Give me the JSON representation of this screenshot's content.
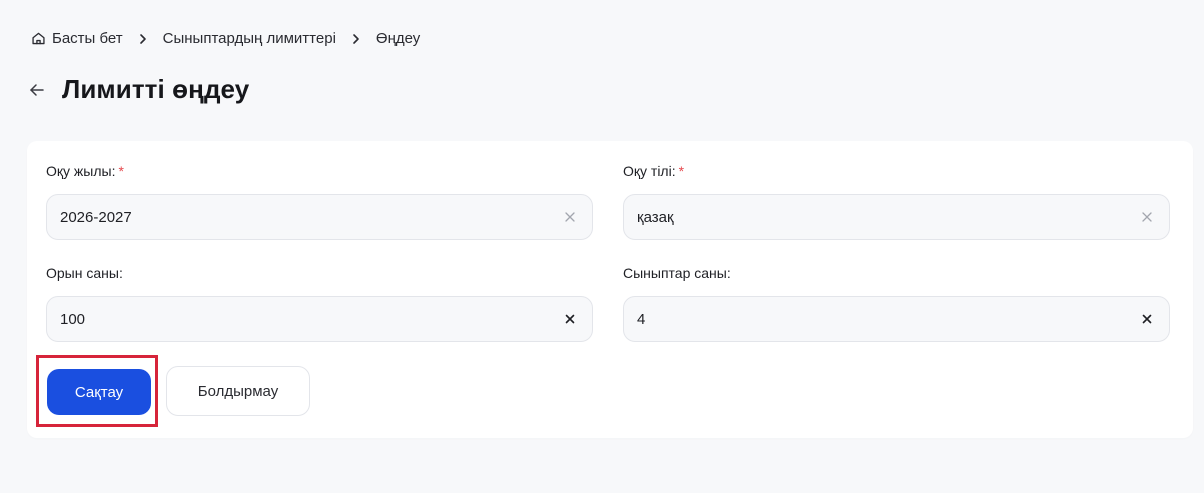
{
  "breadcrumb": {
    "home": "Басты бет",
    "limits": "Сыныптардың лимиттері",
    "current": "Өңдеу"
  },
  "page": {
    "title": "Лимитті өңдеу"
  },
  "form": {
    "year": {
      "label": "Оқу жылы:",
      "required": "*",
      "value": "2026-2027"
    },
    "language": {
      "label": "Оқу тілі:",
      "required": "*",
      "value": "қазақ"
    },
    "seats": {
      "label": "Орын саны:",
      "value": "100"
    },
    "classes": {
      "label": "Сыныптар саны:",
      "value": "4"
    }
  },
  "actions": {
    "save_label": "Сақтау",
    "cancel_label": "Болдырмау"
  },
  "colors": {
    "primary": "#1a4fe0",
    "required": "#e5484d",
    "highlight": "#d6243a",
    "background": "#f7f8fa"
  },
  "icons": {
    "home": "home-icon",
    "separator": "chevron-right-icon",
    "back": "arrow-left-icon",
    "clear": "close-icon"
  }
}
